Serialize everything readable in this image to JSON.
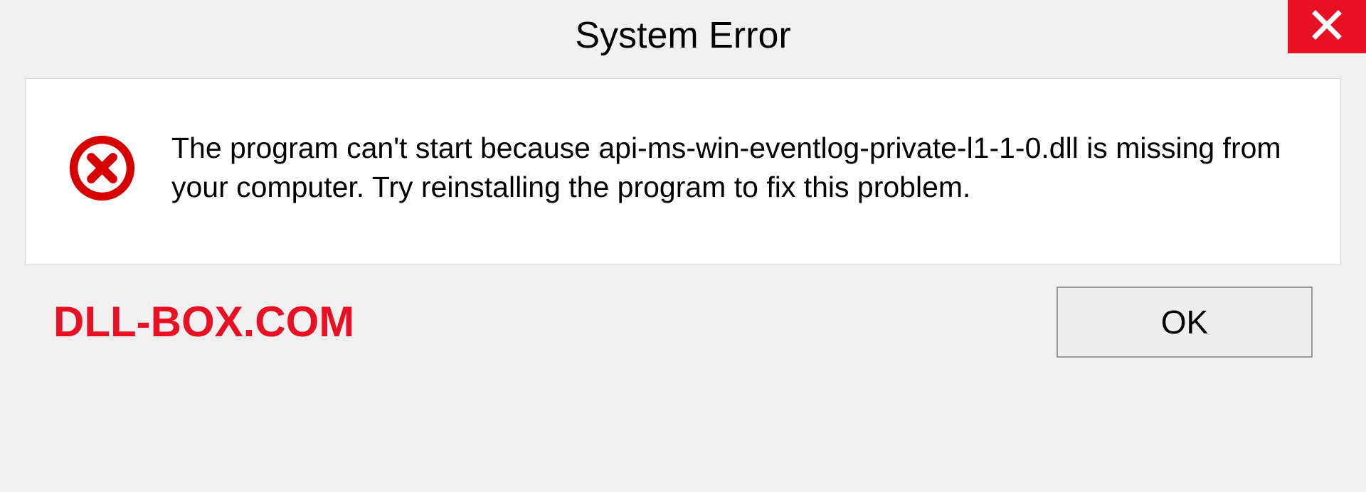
{
  "title": "System Error",
  "message": "The program can't start because api-ms-win-eventlog-private-l1-1-0.dll is missing from your computer. Try reinstalling the program to fix this problem.",
  "watermark": "DLL-BOX.COM",
  "ok_button_label": "OK"
}
